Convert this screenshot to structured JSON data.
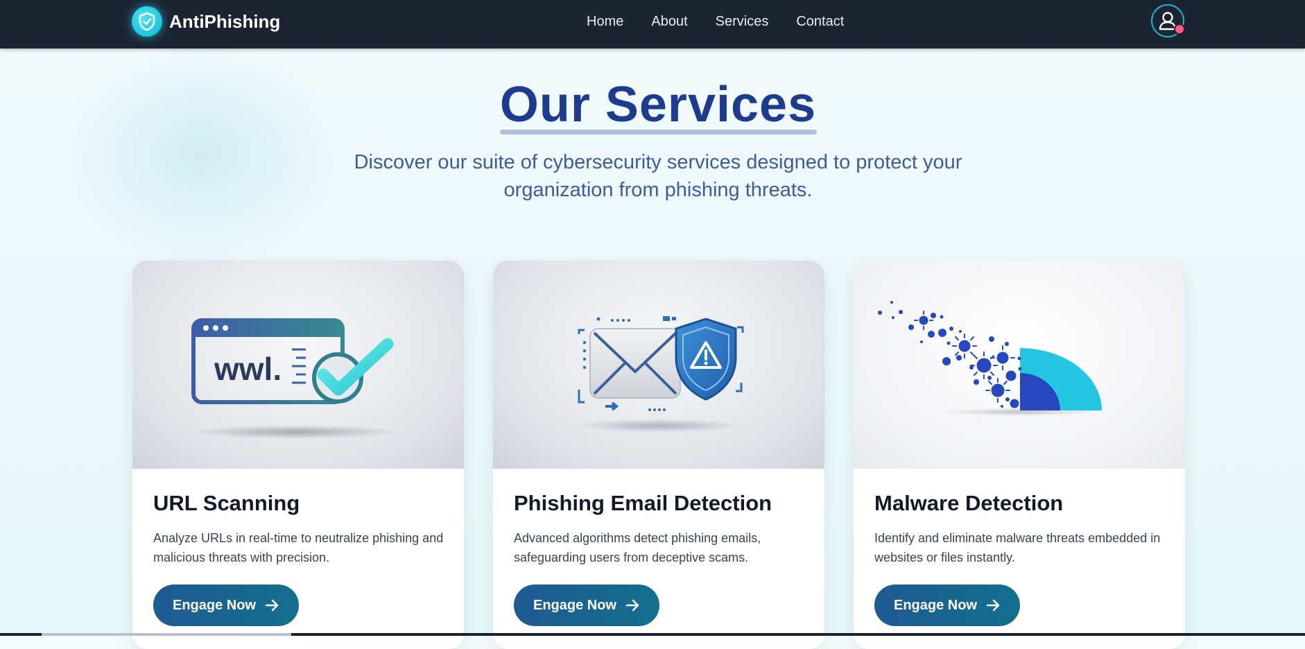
{
  "navbar": {
    "brand": "AntiPhishing",
    "links": [
      {
        "label": "Home"
      },
      {
        "label": "About"
      },
      {
        "label": "Services"
      },
      {
        "label": "Contact"
      }
    ]
  },
  "hero": {
    "title": "Our Services",
    "subtitle": "Discover our suite of cybersecurity services designed to protect your organization from phishing threats."
  },
  "cards": [
    {
      "title": "URL Scanning",
      "description": "Analyze URLs in real-time to neutralize phishing and malicious threats with precision.",
      "button": "Engage Now",
      "illustration_text": "wwl."
    },
    {
      "title": "Phishing Email Detection",
      "description": "Advanced algorithms detect phishing emails, safeguarding users from deceptive scams.",
      "button": "Engage Now"
    },
    {
      "title": "Malware Detection",
      "description": "Identify and eliminate malware threats embedded in websites or files instantly.",
      "button": "Engage Now"
    }
  ],
  "icons": {
    "brand": "shield-check-icon",
    "avatar": "user-icon",
    "button_arrow": "arrow-right-icon"
  },
  "colors": {
    "navbar": "#1c2432",
    "accent": "#1cc6dc",
    "title": "#1d3b8f",
    "button": "#1f5a94"
  }
}
